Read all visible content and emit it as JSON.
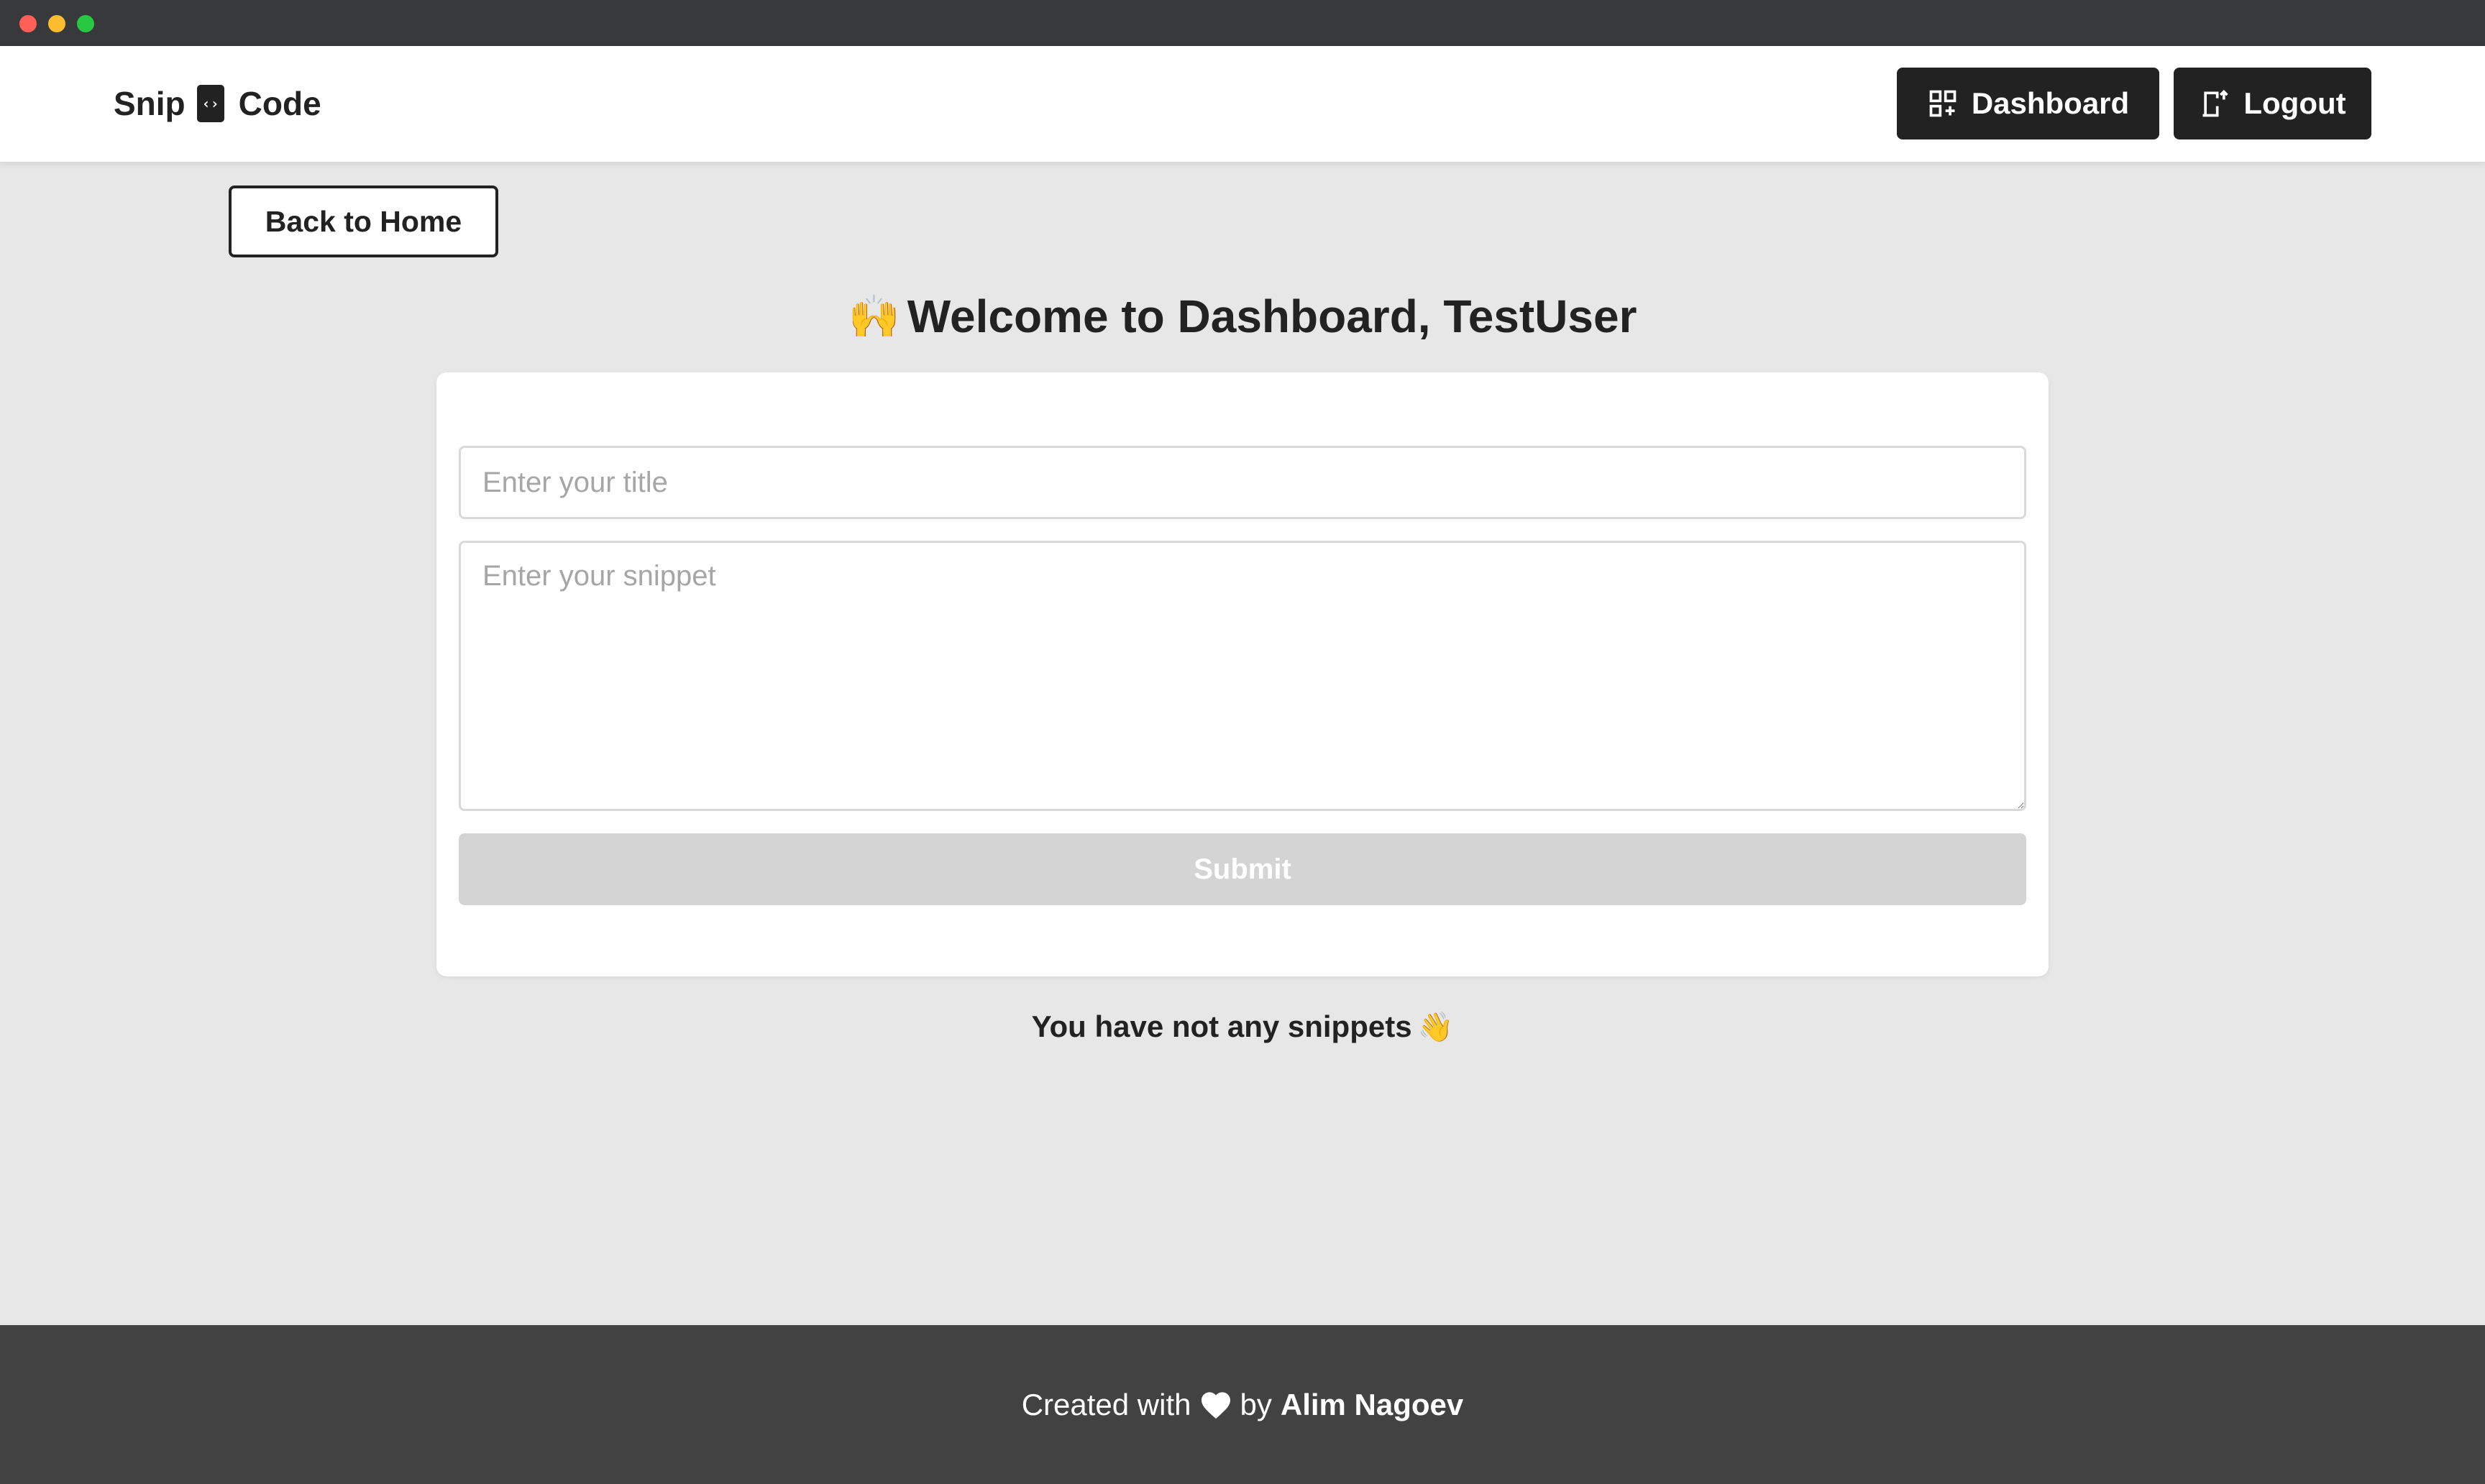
{
  "navbar": {
    "brand_left": "Snip",
    "brand_logo_icon": "code-icon",
    "brand_right": "Code",
    "dashboard_label": "Dashboard",
    "dashboard_icon": "grid-plus-icon",
    "logout_label": "Logout",
    "logout_icon": "door-exit-icon"
  },
  "back_button": {
    "label": "Back to Home"
  },
  "welcome": {
    "emoji": "🙌",
    "text": "Welcome to Dashboard, TestUser"
  },
  "form": {
    "title_placeholder": "Enter your title",
    "title_value": "",
    "snippet_placeholder": "Enter your snippet",
    "snippet_value": "",
    "submit_label": "Submit"
  },
  "empty_state": {
    "text": "You have not any snippets",
    "emoji": "👋"
  },
  "footer": {
    "prefix": "Created with",
    "heart_icon": "heart-icon",
    "by": "by",
    "author": "Alim Nagoev"
  },
  "colors": {
    "titlebar": "#38393b",
    "page_bg": "#e7e7e7",
    "dark": "#222222",
    "footer_bg": "#424242",
    "submit_disabled": "#d4d4d4"
  }
}
